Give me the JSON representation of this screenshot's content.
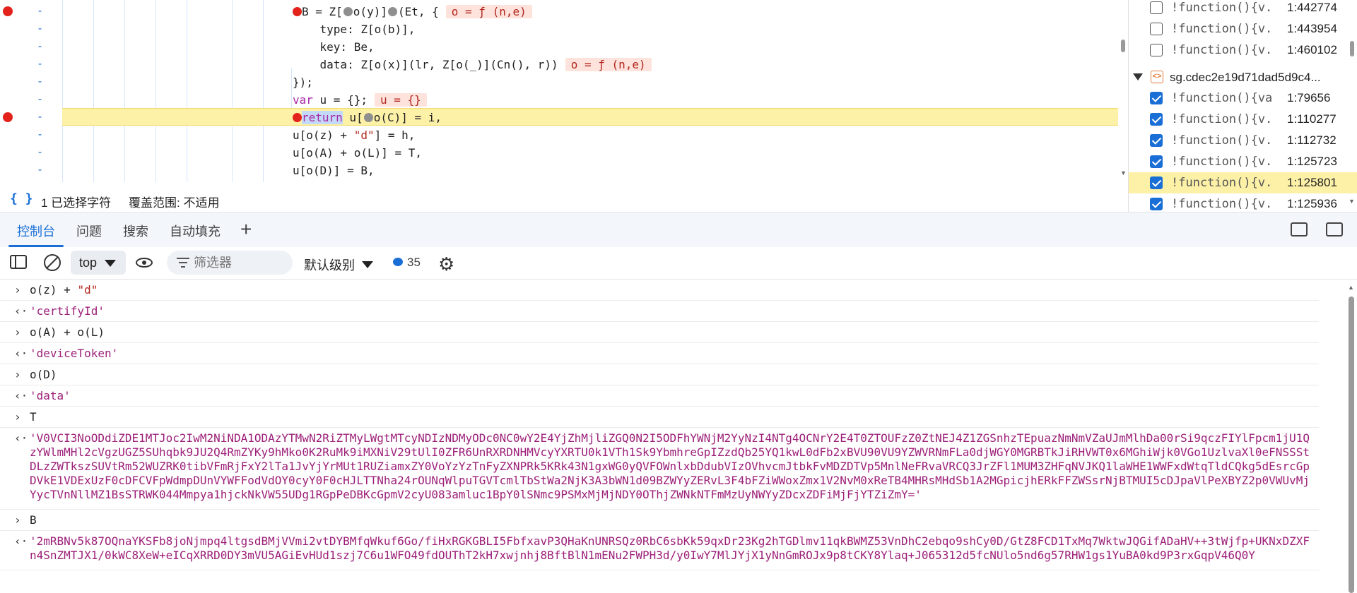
{
  "editor": {
    "lines": [
      {
        "bp": true,
        "html_key": "l0"
      },
      {
        "bp": false,
        "html_key": "l1"
      },
      {
        "bp": false,
        "html_key": "l2"
      },
      {
        "bp": false,
        "html_key": "l3"
      },
      {
        "bp": false,
        "html_key": "l4"
      },
      {
        "bp": false,
        "html_key": "l5"
      },
      {
        "bp": true,
        "html_key": "l6"
      },
      {
        "bp": false,
        "html_key": "l7"
      },
      {
        "bp": false,
        "html_key": "l8"
      },
      {
        "bp": false,
        "html_key": "l9"
      }
    ],
    "line_marker": "-",
    "code": {
      "l0_a": "B = Z[",
      "l0_b": "o(y)]",
      "l0_c": "(Et, {",
      "l0_hint": "o = ƒ (n,e)",
      "l1": "    type: Z[o(b)],",
      "l2": "    key: Be,",
      "l3_a": "    data: Z[o(x)](lr, Z[o(_)](Cn(), r))",
      "l3_hint": "o = ƒ (n,e)",
      "l4": "});",
      "l5_kw": "var",
      "l5_a": " u = {};",
      "l5_hint": "u = {}",
      "l6_kw": "return",
      "l6_a": " u[",
      "l6_b": "o(C)] = i,",
      "l7_a": "u[o(z) + ",
      "l7_str": "\"d\"",
      "l7_b": "] = h,",
      "l8": "u[o(A) + o(L)] = T,",
      "l9": "u[o(D)] = B,"
    }
  },
  "status": {
    "braces": "{ }",
    "selected_chars": "1 已选择字符",
    "coverage": "覆盖范围: 不适用"
  },
  "breakpoints": {
    "top_items": [
      {
        "fn": "!function(){v...",
        "loc": "1:442774",
        "checked": false
      },
      {
        "fn": "!function(){v...",
        "loc": "1:443954",
        "checked": false
      },
      {
        "fn": "!function(){v...",
        "loc": "1:460102",
        "checked": false
      }
    ],
    "file": {
      "icon": "<>",
      "name": "sg.cdec2e19d71dad5d9c4..."
    },
    "file_items": [
      {
        "fn": "!function(){va...",
        "loc": "1:79656",
        "checked": true
      },
      {
        "fn": "!function(){v...",
        "loc": "1:110277",
        "checked": true
      },
      {
        "fn": "!function(){v...",
        "loc": "1:112732",
        "checked": true
      },
      {
        "fn": "!function(){v...",
        "loc": "1:125723",
        "checked": true
      },
      {
        "fn": "!function(){v...",
        "loc": "1:125801",
        "checked": true,
        "highlight": true
      },
      {
        "fn": "!function(){v...",
        "loc": "1:125936",
        "checked": true
      }
    ]
  },
  "drawer": {
    "tabs": [
      "控制台",
      "问题",
      "搜索",
      "自动填充"
    ],
    "plus": "+"
  },
  "toolbar": {
    "context": "top",
    "filter_placeholder": "筛选器",
    "levels": "默认级别",
    "issues_count": "35"
  },
  "console": {
    "entries": [
      {
        "type": "in",
        "text": "o(z) + \"d\""
      },
      {
        "type": "out",
        "text": "'certifyId'"
      },
      {
        "type": "in",
        "text": "o(A) + o(L)"
      },
      {
        "type": "out",
        "text": "'deviceToken'"
      },
      {
        "type": "in",
        "text": "o(D)"
      },
      {
        "type": "out",
        "text": "'data'"
      },
      {
        "type": "in",
        "text": "T"
      },
      {
        "type": "out",
        "text": "'V0VCI3NoODdiZDE1MTJoc2IwM2NiNDA1ODAzYTMwN2RiZTMyLWgtMTcyNDIzNDMyODc0NC0wY2E4YjZhMjliZGQ0N2I5ODFhYWNjM2YyNzI4NTg4OCNrY2E4T0ZTOUFzZ0ZtNEJ4Z1ZGSnhzTEpuazNmNmVZaUJmMlhDa00rSi9qczFIYlFpcm1jU1QzYWlmMHl2cVgzUGZ5SUhqbk9JU2Q4RmZYKy9hMko0K2RuMk9iMXNiV29tUlI0ZFR6UnRXRDNHMVcyYXRTU0k1VTh1Sk9YbmhreGpIZzdQb25YQ1kwL0dFb2xBVU90VU9YZWVRNmFLa0djWGY0MGRBTkJiRHVWT0x6MGhiWjk0VGo1UzlvaXl0eFNSSStDLzZWTkszSUVtRm52WUZRK0tibVFmRjFxY2lTa1JvYjYrMUt1RUZiamxZY0VoYzYzTnFyZXNPRk5KRk43N1gxWG0yQVFOWnlxbDdubVIzOVhvcmJtbkFvMDZDTVp5MnlNeFRvaVRCQ3JrZFl1MUM3ZHFqNVJKQ1laWHE1WWFxdWtqTldCQkg5dEsrcGpDVkE1VDExUzF0cDFCVFpWdmpDUnVYWFFodVdOY0cyY0F0cHJLTTNha24rOUNqWlpuTGVTcmlTbStWa2NjK3A3bWN1d09BZWYyZERvL3F4bFZiWWoxZmx1V2NvM0xReTB4MHRsMHdSb1A2MGpicjhERkFFZWSsrNjBTMUI5cDJpaVlPeXBYZ2p0VWUvMjYycTVnNllMZ1BsSTRWK044Mmpya1hjckNkVW55UDg1RGpPeDBKcGpmV2cyU083amluc1BpY0lSNmc9PSMxMjMjNDY0OThjZWNkNTFmMzUyNWYyZDcxZDFiMjFjYTZiZmY='"
      },
      {
        "type": "in",
        "text": "B"
      },
      {
        "type": "out",
        "text": "'2mRBNv5k87OQnaYKSFb8joNjmpq4ltgsdBMjVVmi2vtDYBMfqWkuf6Go/fiHxRGKGBLI5FbfxavP3QHaKnUNRSQz0RbC6sbKk59qxDr23Kg2hTGDlmv11qkBWMZ53VnDhC2ebqo9shCy0D/GtZ8FCD1TxMq7WktwJQGifADaHV++3tWjfp+UKNxDZXFn4SnZMTJX1/0kWC8XeW+eICqXRRD0DY3mVU5AGiEvHUd1szj7C6u1WFO49fdOUThT2kH7xwjnhj8BftBlN1mENu2FWPH3d/y0IwY7MlJYjX1yNnGmROJx9p8tCKY8Ylaq+J065312d5fcNUlo5nd6g57RHW1gs1YuBA0kd9P3rxGqpV46Q0Y"
      }
    ]
  },
  "colors": {
    "accent": "#1a6fd6",
    "breakpoint": "#e3221b",
    "current_line": "#fdf1a8",
    "string": "#b3261e",
    "console_output": "#9c1f78"
  }
}
